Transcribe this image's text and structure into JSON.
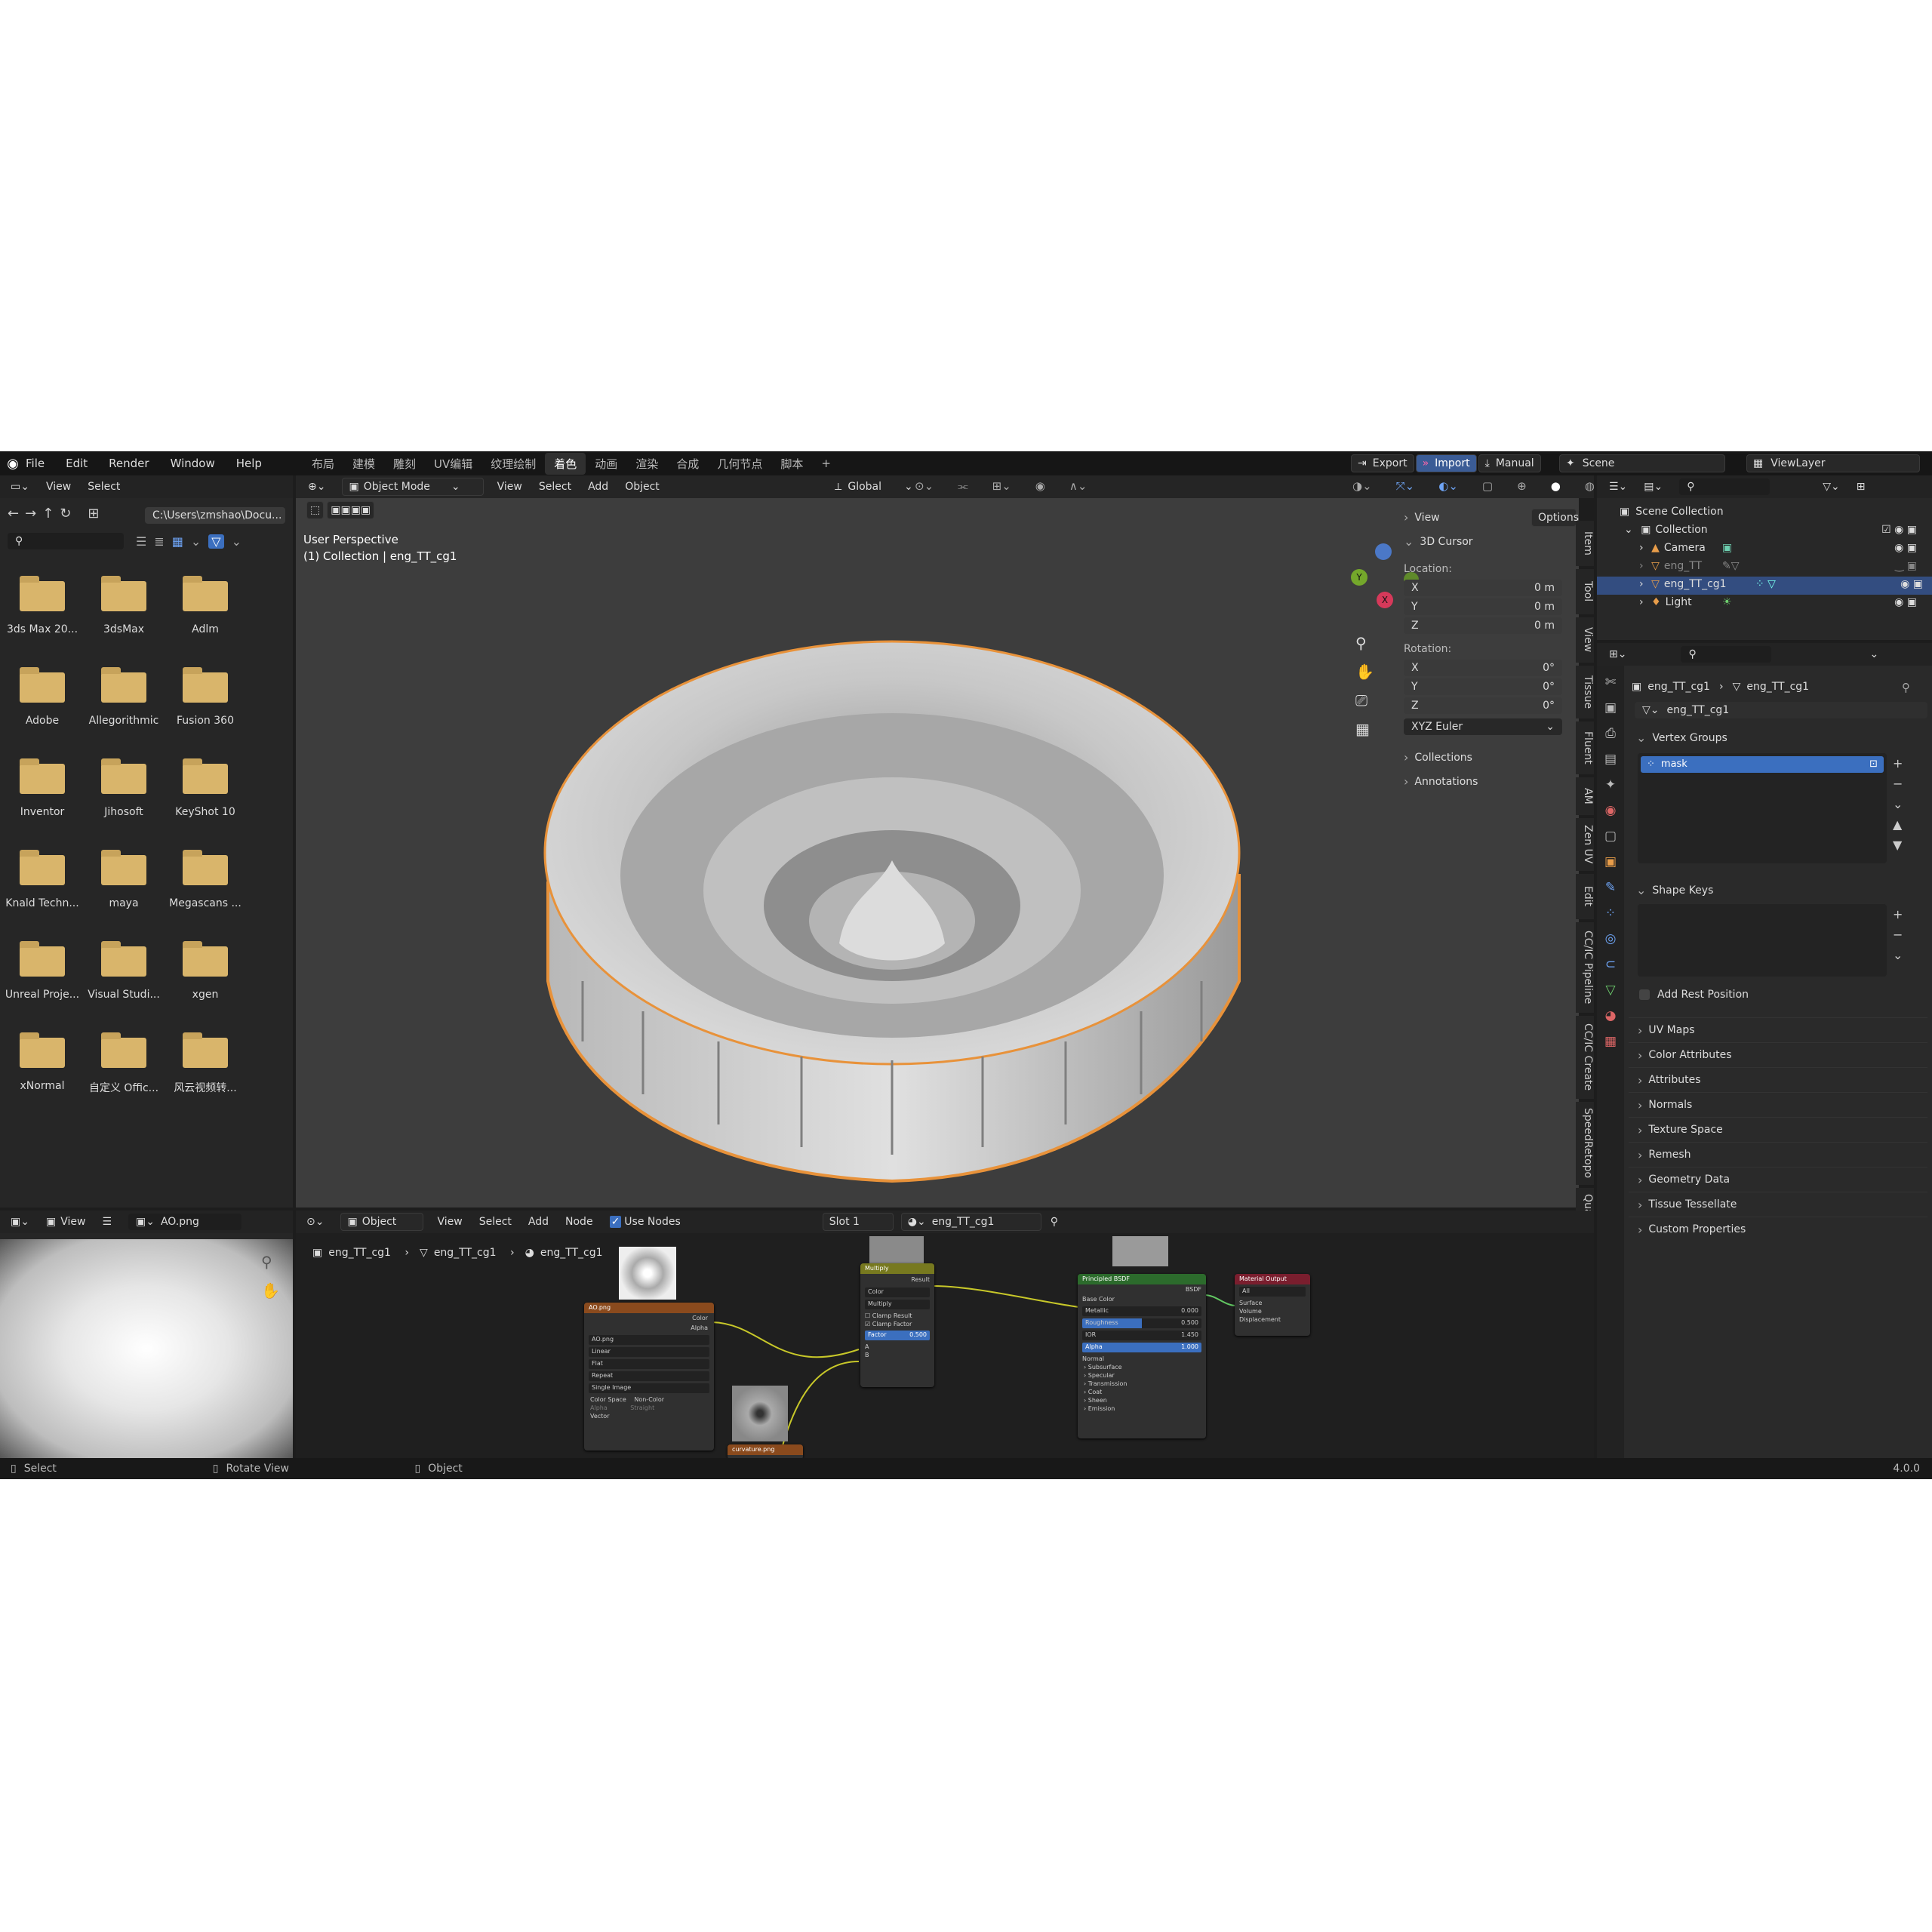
{
  "topbar": {
    "menu": [
      "File",
      "Edit",
      "Render",
      "Window",
      "Help"
    ],
    "workspace_tabs": [
      "布局",
      "建模",
      "雕刻",
      "UV编辑",
      "纹理绘制",
      "着色",
      "动画",
      "渲染",
      "合成",
      "几何节点",
      "脚本"
    ],
    "active_tab": "着色",
    "add_tab": "+",
    "export_label": "Export",
    "import_label": "Import",
    "manual_label": "Manual",
    "scene_label": "Scene",
    "viewlayer_label": "ViewLayer"
  },
  "file_browser": {
    "menu": [
      "View",
      "Select"
    ],
    "path": "C:\\Users\\zmshao\\Docu...",
    "folders": [
      "3ds Max 20...",
      "3dsMax",
      "Adlm",
      "Adobe",
      "Allegorithmic",
      "Fusion 360",
      "Inventor",
      "Jihosoft",
      "KeyShot 10",
      "Knald Techn...",
      "maya",
      "Megascans ...",
      "Unreal Proje...",
      "Visual Studi...",
      "xgen",
      "xNormal",
      "自定义 Offic...",
      "风云视频转..."
    ]
  },
  "viewport": {
    "mode": "Object Mode",
    "menu": [
      "View",
      "Select",
      "Add",
      "Object"
    ],
    "orientation": "Global",
    "options_label": "Options",
    "overlay_line1": "User Perspective",
    "overlay_line2": "(1) Collection | eng_TT_cg1",
    "gizmo": {
      "x": "X",
      "y": "Y",
      "z": "Z"
    }
  },
  "npanel": {
    "view_label": "View",
    "cursor_label": "3D Cursor",
    "location_label": "Location:",
    "location": [
      {
        "axis": "X",
        "value": "0 m"
      },
      {
        "axis": "Y",
        "value": "0 m"
      },
      {
        "axis": "Z",
        "value": "0 m"
      }
    ],
    "rotation_label": "Rotation:",
    "rotation": [
      {
        "axis": "X",
        "value": "0°"
      },
      {
        "axis": "Y",
        "value": "0°"
      },
      {
        "axis": "Z",
        "value": "0°"
      }
    ],
    "rotation_mode": "XYZ Euler",
    "collections_label": "Collections",
    "annotations_label": "Annotations",
    "side_tabs": [
      "Item",
      "Tool",
      "View",
      "Tissue",
      "Fluent",
      "AM",
      "Zen UV",
      "Edit",
      "CC/IC Pipeline",
      "CC/IC Create",
      "SpeedRetopo",
      "QuadRemes"
    ]
  },
  "outliner": {
    "root": "Scene Collection",
    "collection": "Collection",
    "items": [
      "Camera",
      "eng_TT",
      "eng_TT_cg1",
      "Light"
    ]
  },
  "properties": {
    "breadcrumb_obj": "eng_TT_cg1",
    "breadcrumb_data": "eng_TT_cg1",
    "mesh_name": "eng_TT_cg1",
    "vertex_groups_label": "Vertex Groups",
    "vertex_group_item": "mask",
    "shape_keys_label": "Shape Keys",
    "add_rest_position": "Add Rest Position",
    "sections": [
      "UV Maps",
      "Color Attributes",
      "Attributes",
      "Normals",
      "Texture Space",
      "Remesh",
      "Geometry Data",
      "Tissue Tessellate",
      "Custom Properties"
    ]
  },
  "image_editor": {
    "view_label": "View",
    "image_name": "AO.png"
  },
  "node_editor": {
    "object_label": "Object",
    "menu": [
      "View",
      "Select",
      "Add",
      "Node"
    ],
    "use_nodes_label": "Use Nodes",
    "slot_label": "Slot 1",
    "material_name": "eng_TT_cg1",
    "breadcrumb": [
      "eng_TT_cg1",
      "eng_TT_cg1",
      "eng_TT_cg1"
    ],
    "nodes": {
      "ao": {
        "title": "AO.png",
        "out_color": "Color",
        "out_alpha": "Alpha",
        "image": "AO.png",
        "interp": "Linear",
        "proj": "Flat",
        "ext": "Repeat",
        "source": "Single Image",
        "cs_label": "Color Space",
        "cs_value": "Non-Color",
        "alpha_label": "Alpha",
        "alpha_value": "Straight",
        "vector": "Vector"
      },
      "multiply": {
        "title": "Multiply",
        "result": "Result",
        "type": "Color",
        "op": "Multiply",
        "clamp_result": "Clamp Result",
        "clamp_factor": "Clamp Factor",
        "factor_label": "Factor",
        "factor_value": "0.500",
        "a": "A",
        "b": "B"
      },
      "bsdf": {
        "title": "Principled BSDF",
        "out": "BSDF",
        "base_color": "Base Color",
        "metallic_label": "Metallic",
        "metallic_value": "0.000",
        "roughness_label": "Roughness",
        "roughness_value": "0.500",
        "ior_label": "IOR",
        "ior_value": "1.450",
        "alpha_label": "Alpha",
        "alpha_value": "1.000",
        "normal": "Normal",
        "subs": [
          "Subsurface",
          "Specular",
          "Transmission",
          "Coat",
          "Sheen",
          "Emission"
        ]
      },
      "output": {
        "title": "Material Output",
        "target": "All",
        "surface": "Surface",
        "volume": "Volume",
        "displacement": "Displacement"
      },
      "curvature": {
        "title": "curvature.png"
      }
    }
  },
  "statusbar": {
    "select": "Select",
    "rotate": "Rotate View",
    "object": "Object",
    "version": "4.0.0"
  }
}
